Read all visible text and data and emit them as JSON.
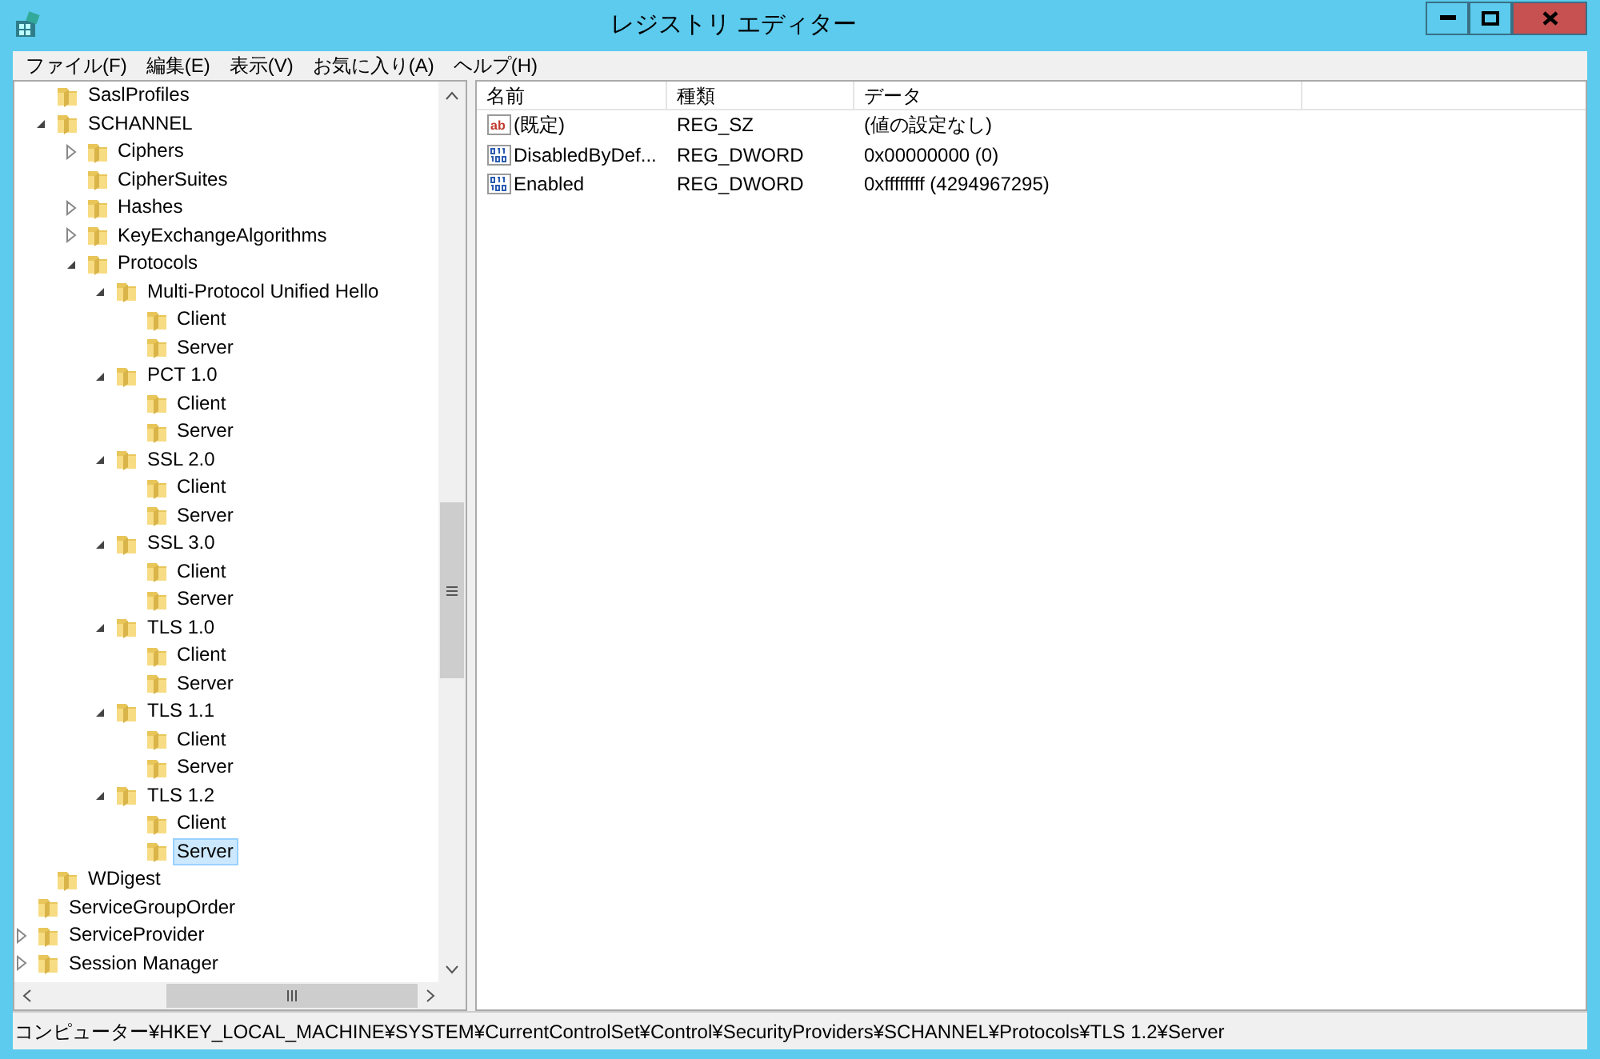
{
  "window": {
    "title": "レジストリ エディター"
  },
  "menu": [
    "ファイル(F)",
    "編集(E)",
    "表示(V)",
    "お気に入り(A)",
    "ヘルプ(H)"
  ],
  "tree": {
    "items": [
      {
        "children": [
          {
            "label": "SaslProfiles",
            "selected": false
          },
          {
            "label": "SCHANNEL",
            "expanded": true,
            "selected": false,
            "children": [
              {
                "label": "Ciphers",
                "expanded": false,
                "selected": false
              },
              {
                "label": "CipherSuites",
                "selected": false
              },
              {
                "label": "Hashes",
                "expanded": false,
                "selected": false
              },
              {
                "label": "KeyExchangeAlgorithms",
                "expanded": false,
                "selected": false
              },
              {
                "label": "Protocols",
                "expanded": true,
                "selected": false,
                "children": [
                  {
                    "label": "Multi-Protocol Unified Hello",
                    "expanded": true,
                    "selected": false,
                    "children": [
                      {
                        "label": "Client",
                        "selected": false
                      },
                      {
                        "label": "Server",
                        "selected": false
                      }
                    ]
                  },
                  {
                    "label": "PCT 1.0",
                    "expanded": true,
                    "selected": false,
                    "children": [
                      {
                        "label": "Client",
                        "selected": false
                      },
                      {
                        "label": "Server",
                        "selected": false
                      }
                    ]
                  },
                  {
                    "label": "SSL 2.0",
                    "expanded": true,
                    "selected": false,
                    "children": [
                      {
                        "label": "Client",
                        "selected": false
                      },
                      {
                        "label": "Server",
                        "selected": false
                      }
                    ]
                  },
                  {
                    "label": "SSL 3.0",
                    "expanded": true,
                    "selected": false,
                    "children": [
                      {
                        "label": "Client",
                        "selected": false
                      },
                      {
                        "label": "Server",
                        "selected": false
                      }
                    ]
                  },
                  {
                    "label": "TLS 1.0",
                    "expanded": true,
                    "selected": false,
                    "children": [
                      {
                        "label": "Client",
                        "selected": false
                      },
                      {
                        "label": "Server",
                        "selected": false
                      }
                    ]
                  },
                  {
                    "label": "TLS 1.1",
                    "expanded": true,
                    "selected": false,
                    "children": [
                      {
                        "label": "Client",
                        "selected": false
                      },
                      {
                        "label": "Server",
                        "selected": false
                      }
                    ]
                  },
                  {
                    "label": "TLS 1.2",
                    "expanded": true,
                    "selected": false,
                    "children": [
                      {
                        "label": "Client",
                        "selected": false
                      },
                      {
                        "label": "Server",
                        "selected": true
                      }
                    ]
                  }
                ]
              }
            ]
          },
          {
            "label": "WDigest",
            "selected": false
          }
        ]
      },
      {
        "label": "ServiceGroupOrder",
        "selected": false
      },
      {
        "label": "ServiceProvider",
        "expanded": false,
        "selected": false
      },
      {
        "label": "Session Manager",
        "expanded": false,
        "selected": false
      }
    ]
  },
  "values": {
    "columns": [
      "名前",
      "種類",
      "データ"
    ],
    "rows": [
      {
        "kind": "string",
        "icon_text": "ab",
        "name": "(既定)",
        "type": "REG_SZ",
        "data": "(値の設定なし)"
      },
      {
        "kind": "number",
        "name": "DisabledByDef...",
        "type": "REG_DWORD",
        "data": "0x00000000 (0)"
      },
      {
        "kind": "number",
        "name": "Enabled",
        "type": "REG_DWORD",
        "data": "0xffffffff (4294967295)"
      }
    ]
  },
  "status_bar": "コンピューター¥HKEY_LOCAL_MACHINE¥SYSTEM¥CurrentControlSet¥Control¥SecurityProviders¥SCHANNEL¥Protocols¥TLS 1.2¥Server"
}
